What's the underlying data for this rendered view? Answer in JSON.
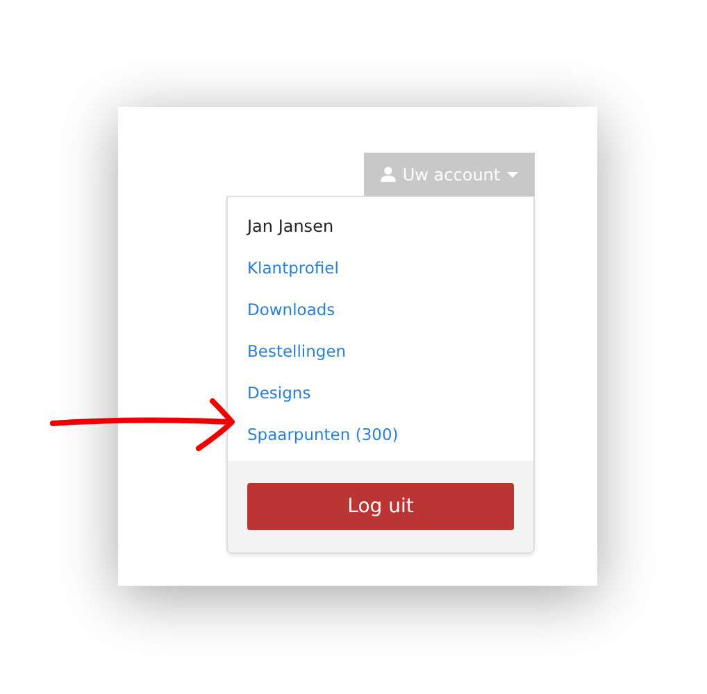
{
  "account_button": {
    "label": "Uw account"
  },
  "menu": {
    "user_name": "Jan Jansen",
    "items": [
      {
        "label": "Klantprofiel"
      },
      {
        "label": "Downloads"
      },
      {
        "label": "Bestellingen"
      },
      {
        "label": "Designs"
      },
      {
        "label": "Spaarpunten (300)"
      }
    ],
    "logout_button": {
      "label": "Log uit"
    }
  }
}
